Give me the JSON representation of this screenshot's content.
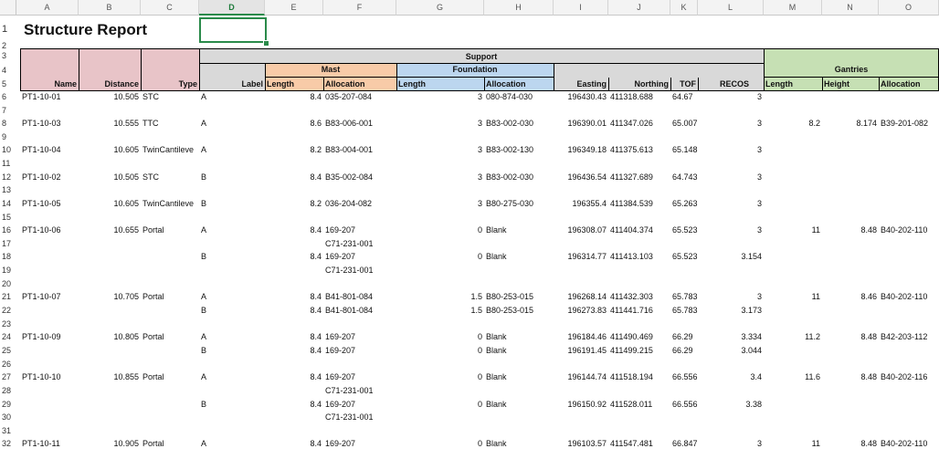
{
  "columns": [
    "A",
    "B",
    "C",
    "D",
    "E",
    "F",
    "G",
    "H",
    "I",
    "J",
    "K",
    "L",
    "M",
    "N",
    "O"
  ],
  "selected_column": "D",
  "title": "Structure Report",
  "headers": {
    "support": "Support",
    "mast": "Mast",
    "foundation": "Foundation",
    "gantries": "Gantries",
    "name": "Name",
    "distance": "Distance",
    "type": "Type",
    "label": "Label",
    "mast_length": "Length",
    "mast_allocation": "Allocation",
    "foundation_length": "Length",
    "foundation_allocation": "Allocation",
    "easting": "Easting",
    "northing": "Northing",
    "tof": "TOF",
    "recos": "RECOS",
    "gantry_length": "Length",
    "gantry_height": "Height",
    "gantry_allocation": "Allocation"
  },
  "rows": [
    {
      "n": "6",
      "name": "PT1-10-01",
      "dist": "10.505",
      "type": "STC",
      "label": "A",
      "ml": "8.4",
      "ma": "035-207-084",
      "fl": "3",
      "fa": "080-874-030",
      "e": "196430.43",
      "no": "411318.688",
      "tof": "64.67",
      "recos": "3",
      "gl": "",
      "gh": "",
      "ga": ""
    },
    {
      "n": "7"
    },
    {
      "n": "8",
      "name": "PT1-10-03",
      "dist": "10.555",
      "type": "TTC",
      "label": "A",
      "ml": "8.6",
      "ma": "B83-006-001",
      "fl": "3",
      "fa": "B83-002-030",
      "e": "196390.01",
      "no": "411347.026",
      "tof": "65.007",
      "recos": "3",
      "gl": "8.2",
      "gh": "8.174",
      "ga": "B39-201-082"
    },
    {
      "n": "9"
    },
    {
      "n": "10",
      "name": "PT1-10-04",
      "dist": "10.605",
      "type": "TwinCantileve",
      "label": "A",
      "ml": "8.2",
      "ma": "B83-004-001",
      "fl": "3",
      "fa": "B83-002-130",
      "e": "196349.18",
      "no": "411375.613",
      "tof": "65.148",
      "recos": "3",
      "gl": "",
      "gh": "",
      "ga": ""
    },
    {
      "n": "11"
    },
    {
      "n": "12",
      "name": "PT1-10-02",
      "dist": "10.505",
      "type": "STC",
      "label": "B",
      "ml": "8.4",
      "ma": "B35-002-084",
      "fl": "3",
      "fa": "B83-002-030",
      "e": "196436.54",
      "no": "411327.689",
      "tof": "64.743",
      "recos": "3",
      "gl": "",
      "gh": "",
      "ga": ""
    },
    {
      "n": "13"
    },
    {
      "n": "14",
      "name": "PT1-10-05",
      "dist": "10.605",
      "type": "TwinCantileve",
      "label": "B",
      "ml": "8.2",
      "ma": "036-204-082",
      "fl": "3",
      "fa": "B80-275-030",
      "e": "196355.4",
      "no": "411384.539",
      "tof": "65.263",
      "recos": "3",
      "gl": "",
      "gh": "",
      "ga": ""
    },
    {
      "n": "15"
    },
    {
      "n": "16",
      "name": "PT1-10-06",
      "dist": "10.655",
      "type": "Portal",
      "label": "A",
      "ml": "8.4",
      "ma": "169-207",
      "fl": "0",
      "fa": "Blank",
      "e": "196308.07",
      "no": "411404.374",
      "tof": "65.523",
      "recos": "3",
      "gl": "11",
      "gh": "8.48",
      "ga": "B40-202-110"
    },
    {
      "n": "17",
      "ma": "C71-231-001"
    },
    {
      "n": "18",
      "label": "B",
      "ml": "8.4",
      "ma": "169-207",
      "fl": "0",
      "fa": "Blank",
      "e": "196314.77",
      "no": "411413.103",
      "tof": "65.523",
      "recos": "3.154"
    },
    {
      "n": "19",
      "ma": "C71-231-001"
    },
    {
      "n": "20"
    },
    {
      "n": "21",
      "name": "PT1-10-07",
      "dist": "10.705",
      "type": "Portal",
      "label": "A",
      "ml": "8.4",
      "ma": "B41-801-084",
      "fl": "1.5",
      "fa": "B80-253-015",
      "e": "196268.14",
      "no": "411432.303",
      "tof": "65.783",
      "recos": "3",
      "gl": "11",
      "gh": "8.46",
      "ga": "B40-202-110"
    },
    {
      "n": "22",
      "label": "B",
      "ml": "8.4",
      "ma": "B41-801-084",
      "fl": "1.5",
      "fa": "B80-253-015",
      "e": "196273.83",
      "no": "411441.716",
      "tof": "65.783",
      "recos": "3.173"
    },
    {
      "n": "23"
    },
    {
      "n": "24",
      "name": "PT1-10-09",
      "dist": "10.805",
      "type": "Portal",
      "label": "A",
      "ml": "8.4",
      "ma": "169-207",
      "fl": "0",
      "fa": "Blank",
      "e": "196184.46",
      "no": "411490.469",
      "tof": "66.29",
      "recos": "3.334",
      "gl": "11.2",
      "gh": "8.48",
      "ga": "B42-203-112"
    },
    {
      "n": "25",
      "label": "B",
      "ml": "8.4",
      "ma": "169-207",
      "fl": "0",
      "fa": "Blank",
      "e": "196191.45",
      "no": "411499.215",
      "tof": "66.29",
      "recos": "3.044"
    },
    {
      "n": "26"
    },
    {
      "n": "27",
      "name": "PT1-10-10",
      "dist": "10.855",
      "type": "Portal",
      "label": "A",
      "ml": "8.4",
      "ma": "169-207",
      "fl": "0",
      "fa": "Blank",
      "e": "196144.74",
      "no": "411518.194",
      "tof": "66.556",
      "recos": "3.4",
      "gl": "11.6",
      "gh": "8.48",
      "ga": "B40-202-116"
    },
    {
      "n": "28",
      "ma": "C71-231-001"
    },
    {
      "n": "29",
      "label": "B",
      "ml": "8.4",
      "ma": "169-207",
      "fl": "0",
      "fa": "Blank",
      "e": "196150.92",
      "no": "411528.011",
      "tof": "66.556",
      "recos": "3.38"
    },
    {
      "n": "30",
      "ma": "C71-231-001"
    },
    {
      "n": "31"
    },
    {
      "n": "32",
      "name": "PT1-10-11",
      "dist": "10.905",
      "type": "Portal",
      "label": "A",
      "ml": "8.4",
      "ma": "169-207",
      "fl": "0",
      "fa": "Blank",
      "e": "196103.57",
      "no": "411547.481",
      "tof": "66.847",
      "recos": "3",
      "gl": "11",
      "gh": "8.48",
      "ga": "B40-202-110"
    }
  ]
}
